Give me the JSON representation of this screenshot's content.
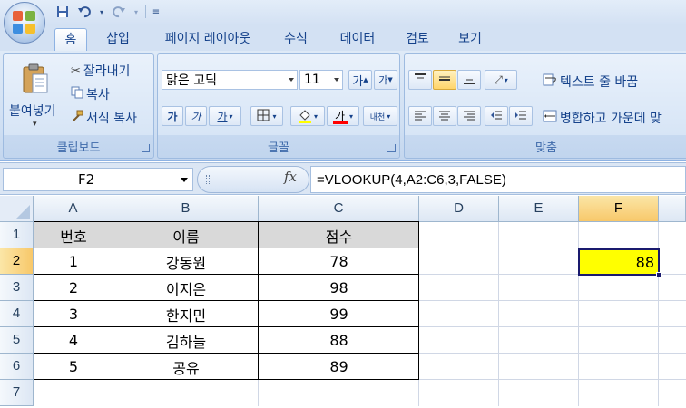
{
  "quick_access": {
    "save_icon": "save-icon",
    "undo_icon": "undo-icon",
    "redo_icon": "redo-icon",
    "customize_icon": "customize-icon"
  },
  "tabs": [
    "홈",
    "삽입",
    "페이지 레이아웃",
    "수식",
    "데이터",
    "검토",
    "보기"
  ],
  "active_tab": "홈",
  "ribbon": {
    "clipboard": {
      "label": "클립보드",
      "paste": "붙여넣기",
      "cut": "잘라내기",
      "copy": "복사",
      "format_painter": "서식 복사"
    },
    "font": {
      "label": "글꼴",
      "font_name": "맑은 고딕",
      "font_size": "11",
      "bold": "가",
      "italic": "가",
      "underline": "가",
      "grow": "가",
      "shrink": "가",
      "phonetic": "내천"
    },
    "alignment": {
      "label": "맞춤",
      "wrap_text": "텍스트 줄 바꿈",
      "merge_center": "병합하고 가운데 맞"
    }
  },
  "formula_bar": {
    "name_box": "F2",
    "fx": "fx",
    "formula": "=VLOOKUP(4,A2:C6,3,FALSE)"
  },
  "columns": [
    "A",
    "B",
    "C",
    "D",
    "E",
    "F"
  ],
  "rows": [
    "1",
    "2",
    "3",
    "4",
    "5",
    "6",
    "7"
  ],
  "table": {
    "headers": [
      "번호",
      "이름",
      "점수"
    ],
    "rows": [
      [
        "1",
        "강동원",
        "78"
      ],
      [
        "2",
        "이지은",
        "98"
      ],
      [
        "3",
        "한지민",
        "99"
      ],
      [
        "4",
        "김하늘",
        "88"
      ],
      [
        "5",
        "공유",
        "89"
      ]
    ]
  },
  "result_cell": {
    "address": "F2",
    "value": "88",
    "fill_color": "#ffff00"
  }
}
